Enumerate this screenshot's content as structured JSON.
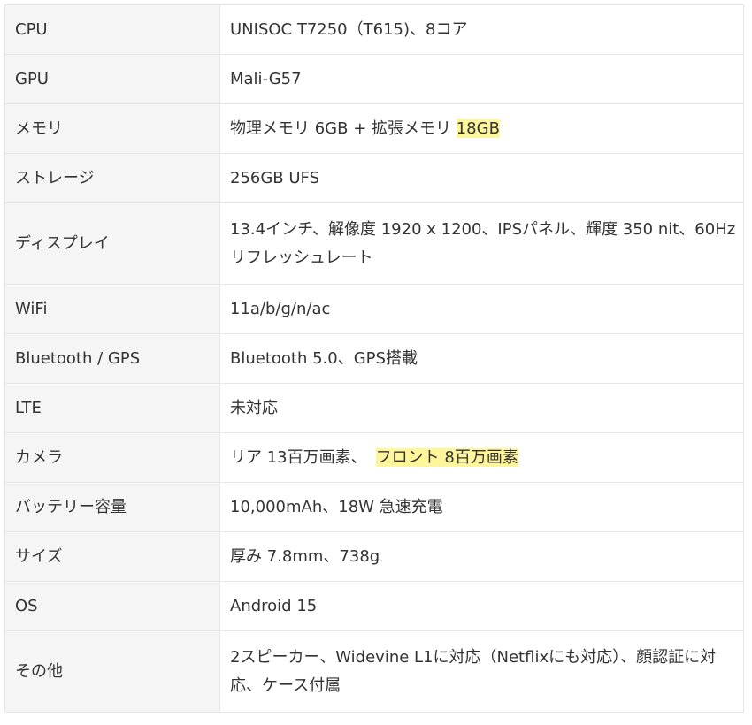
{
  "rows": [
    {
      "label": "CPU",
      "value": "UNISOC T7250（T615)、8コア"
    },
    {
      "label": "GPU",
      "value": "Mali-G57"
    },
    {
      "label": "メモリ",
      "value_pre": "物理メモリ 6GB + 拡張メモリ ",
      "value_hl": "18GB"
    },
    {
      "label": "ストレージ",
      "value": "256GB UFS"
    },
    {
      "label": "ディスプレイ",
      "value": "13.4インチ、解像度 1920 x 1200、IPSパネル、輝度 350 nit、60Hz リフレッシュレート"
    },
    {
      "label": "WiFi",
      "value": "11a/b/g/n/ac"
    },
    {
      "label": "Bluetooth / GPS",
      "value": "Bluetooth 5.0、GPS搭載"
    },
    {
      "label": "LTE",
      "value": "未対応"
    },
    {
      "label": "カメラ",
      "value_pre": "リア 13百万画素、",
      "value_hl": "フロント 8百万画素"
    },
    {
      "label": "バッテリー容量",
      "value": "10,000mAh、18W 急速充電"
    },
    {
      "label": "サイズ",
      "value": "厚み 7.8mm、738g"
    },
    {
      "label": "OS",
      "value": "Android 15"
    },
    {
      "label": "その他",
      "value": "2スピーカー、Widevine L1に対応（Netflixにも対応）、顔認証に対応、ケース付属"
    }
  ],
  "colors": {
    "label_bg": "#f5f5f5",
    "value_bg": "#ffffff",
    "border": "#e6e6e6",
    "highlight": "#fff59a",
    "text": "#333333"
  }
}
